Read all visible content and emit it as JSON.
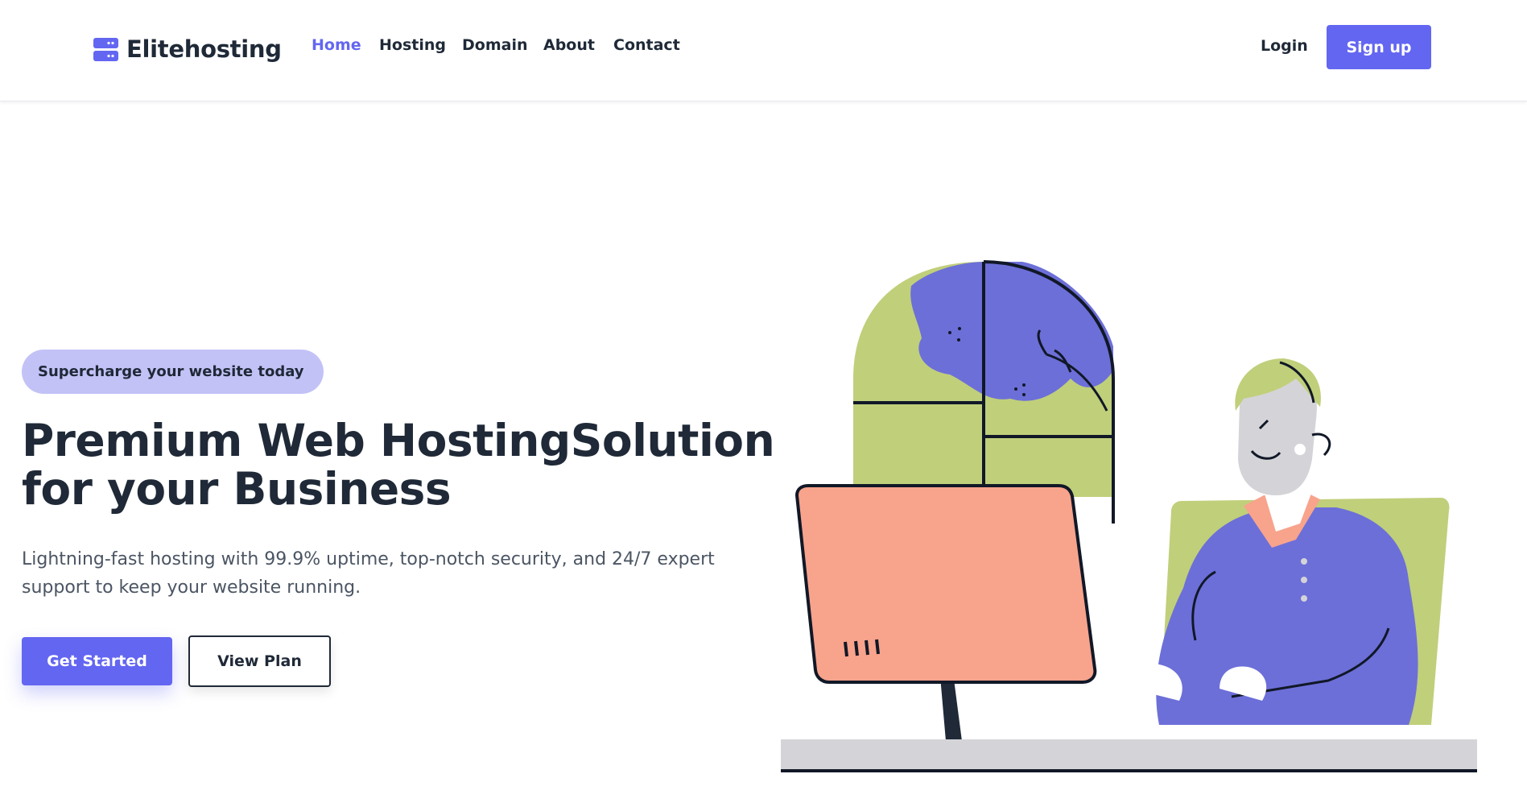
{
  "nav": {
    "brand": "Elitehosting",
    "links": [
      "Home",
      "Hosting",
      "Domain",
      "About",
      "Contact"
    ],
    "active": "Home",
    "login": "Login",
    "signup": "Sign up"
  },
  "hero": {
    "badge": "Supercharge your website today",
    "title_line1": "Premium Web HostingSolution",
    "title_line2": "for your Business",
    "desc_line1": "Lightning-fast hosting with 99.9% uptime, top-notch security, and 24/7 expert",
    "desc_line2": "support to keep your website running.",
    "primary_button": "Get Started",
    "secondary_button": "View Plan"
  },
  "colors": {
    "accent": "#6366f1",
    "badge_bg": "#c3c2f7",
    "text_dark": "#1f2937",
    "text_muted": "#4b5563",
    "illustration_green": "#c0cf7a",
    "illustration_blue": "#6c6fd8",
    "illustration_salmon": "#f8a38c"
  },
  "icons": {
    "logo": "server-icon"
  }
}
